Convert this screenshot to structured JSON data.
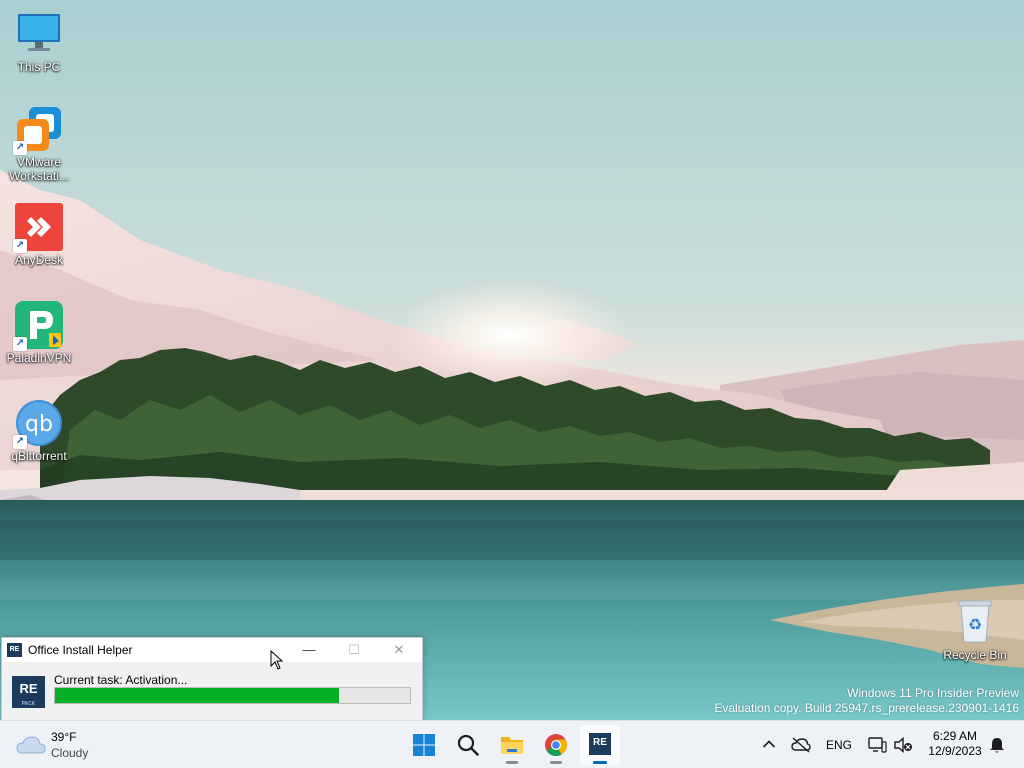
{
  "desktop": {
    "icons": [
      {
        "label": "This PC",
        "icon": "monitor-icon"
      },
      {
        "label": "VMware Workstati...",
        "icon": "vmware-icon"
      },
      {
        "label": "AnyDesk",
        "icon": "anydesk-icon"
      },
      {
        "label": "PaladinVPN",
        "icon": "paladinvpn-icon"
      },
      {
        "label": "qBittorrent",
        "icon": "qbittorrent-icon"
      },
      {
        "label": "Recycle Bin",
        "icon": "recycle-bin-icon"
      }
    ],
    "watermark": {
      "line1": "Windows 11 Pro Insider Preview",
      "line2": "Evaluation copy. Build 25947.rs_prerelease.230901-1416"
    }
  },
  "helper_window": {
    "title": "Office Install Helper",
    "app_icon_text": "RE",
    "app_icon_subtext": "PACK",
    "task_text": "Current task: Activation...",
    "progress": 0.8,
    "controls": {
      "minimize": "—",
      "maximize": "☐",
      "close": "✕"
    }
  },
  "taskbar": {
    "weather": {
      "temp": "39°F",
      "condition": "Cloudy",
      "icon": "cloud-icon"
    },
    "apps": [
      {
        "name": "start",
        "icon": "windows-start-icon"
      },
      {
        "name": "search",
        "icon": "search-icon"
      },
      {
        "name": "file-explorer",
        "icon": "folder-icon"
      },
      {
        "name": "chrome",
        "icon": "chrome-icon"
      },
      {
        "name": "office-install-helper",
        "icon": "repack-icon",
        "label": "RE"
      }
    ],
    "tray": {
      "language": "ENG",
      "icons": [
        "chevron-up-icon",
        "cloud-off-icon",
        "network-icon",
        "volume-muted-icon",
        "notification-bell-icon"
      ]
    },
    "clock": {
      "time": "6:29 AM",
      "date": "12/9/2023"
    }
  },
  "colors": {
    "accent": "#0067c0",
    "progress_fill": "#06b025",
    "taskbar_bg": "#eef2f6",
    "app_icon_bg": "#1b3a5c"
  }
}
